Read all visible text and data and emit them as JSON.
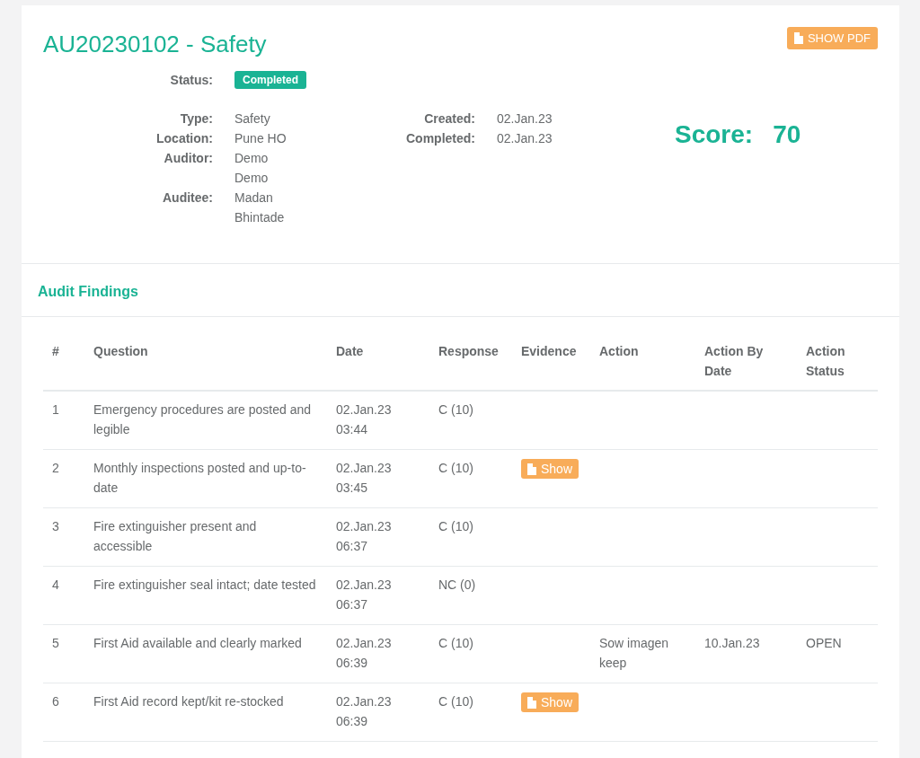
{
  "audit": {
    "title": "AU20230102 - Safety",
    "pdf_button": "SHOW PDF",
    "status_label": "Status:",
    "status": "Completed",
    "details_left": [
      {
        "label": "Type:",
        "value": "Safety"
      },
      {
        "label": "Location:",
        "value": "Pune HO"
      },
      {
        "label": "Auditor:",
        "value": "Demo Demo"
      },
      {
        "label": "Auditee:",
        "value": "Madan Bhintade"
      }
    ],
    "details_right": [
      {
        "label": "Created:",
        "value": "02.Jan.23"
      },
      {
        "label": "Completed:",
        "value": "02.Jan.23"
      }
    ],
    "score_label": "Score:",
    "score": "70"
  },
  "findings": {
    "title": "Audit Findings",
    "columns": [
      "#",
      "Question",
      "Date",
      "Response",
      "Evidence",
      "Action",
      "Action By Date",
      "Action Status"
    ],
    "rows": [
      {
        "number": "1",
        "question": "Emergency procedures are posted and legible",
        "date": "02.Jan.23 03:44",
        "response": "C (10)"
      },
      {
        "number": "2",
        "question": "Monthly inspections posted and up-to-date",
        "date": "02.Jan.23 03:45",
        "response": "C (10)",
        "evidence": "Show"
      },
      {
        "number": "3",
        "question": "Fire extinguisher present and accessible",
        "date": "02.Jan.23 06:37",
        "response": "C (10)"
      },
      {
        "number": "4",
        "question": "Fire extinguisher seal intact; date tested",
        "date": "02.Jan.23 06:37",
        "response": "NC (0)"
      },
      {
        "number": "5",
        "question": "First Aid available and clearly marked",
        "date": "02.Jan.23 06:39",
        "response": "C (10)",
        "action": "Sow imagen keep",
        "action_by_date": "10.Jan.23",
        "action_status": "OPEN"
      },
      {
        "number": "6",
        "question": "First Aid record kept/kit re-stocked",
        "date": "02.Jan.23 06:39",
        "response": "C (10)",
        "evidence": "Show"
      }
    ]
  }
}
